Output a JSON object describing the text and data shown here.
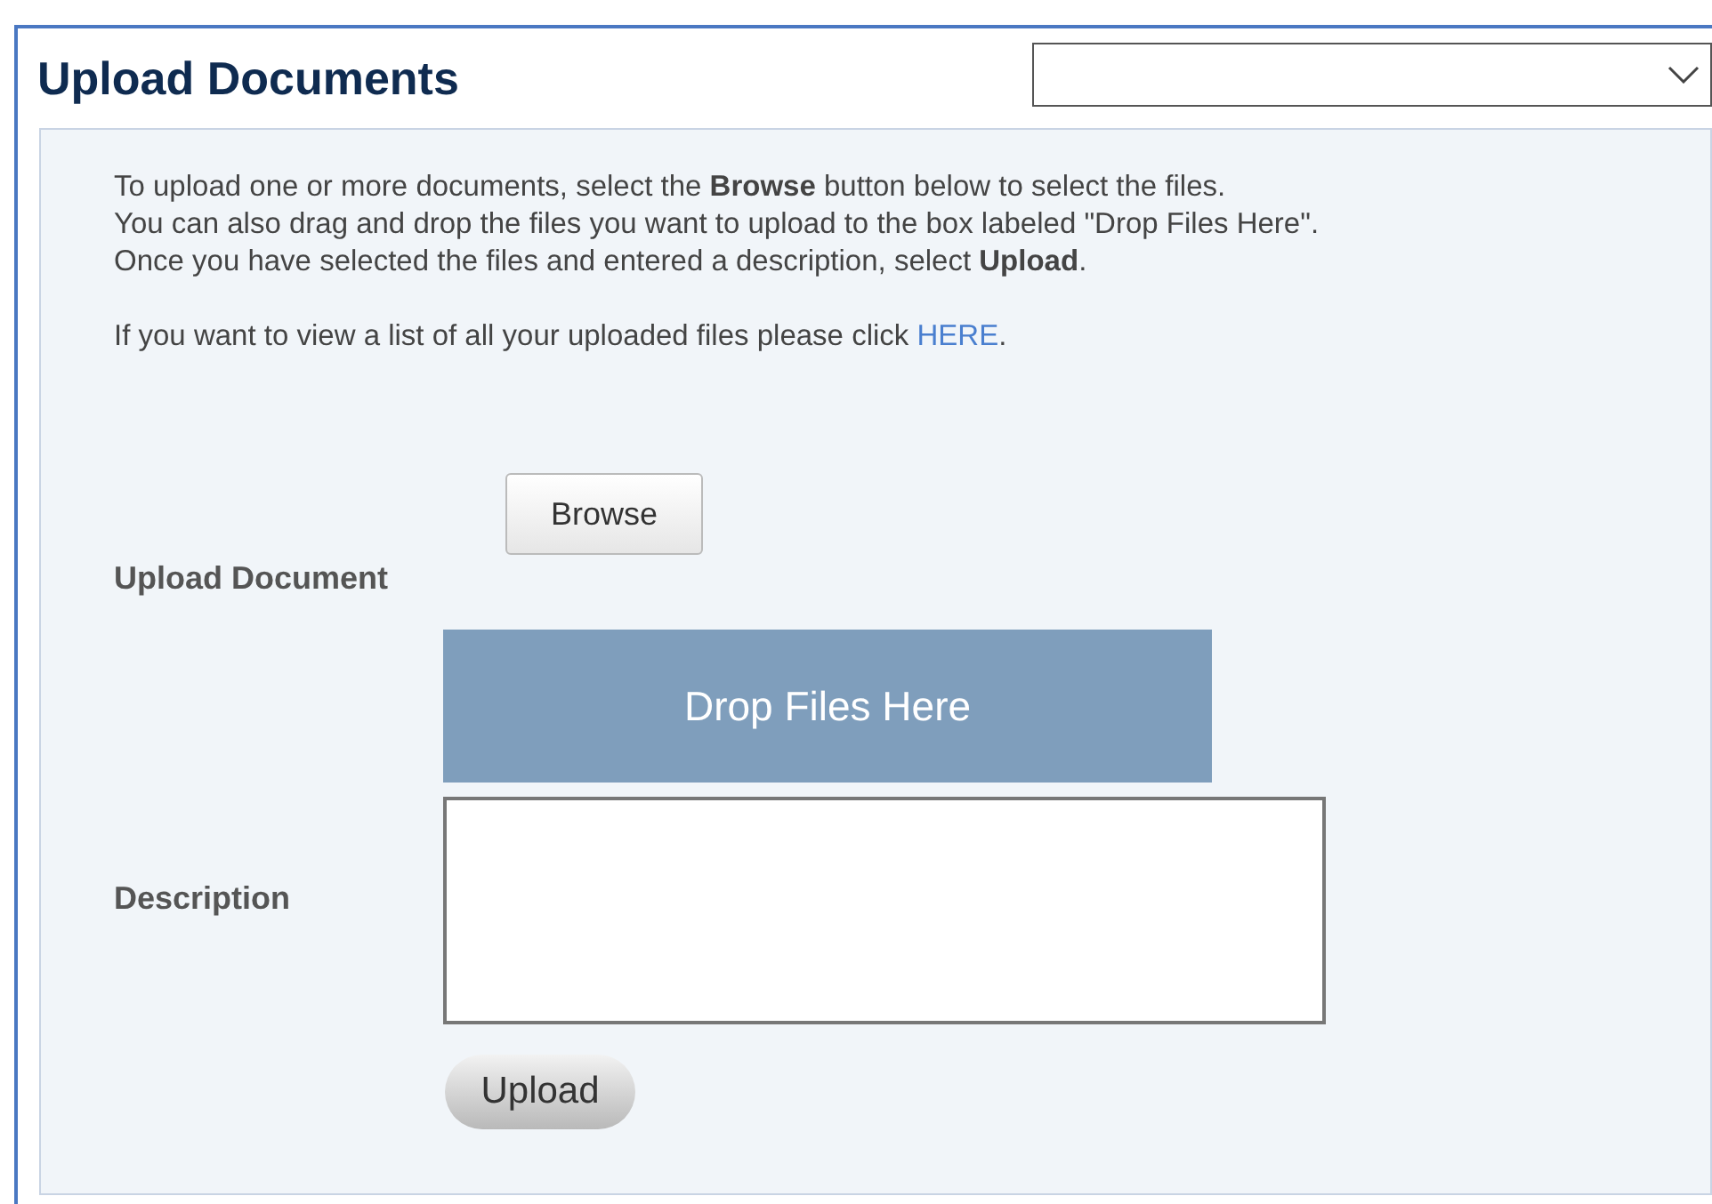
{
  "header": {
    "title": "Upload Documents"
  },
  "intro_lines": [
    "To upload one or more documents, select the **Browse** button below to select the files.",
    "You can also drag and drop the files you want to upload to the box labeled \"Drop Files Here\".",
    "Once you have selected the files and entered a description, select **Upload**."
  ],
  "list_link": {
    "text": "If you want to view a list of all your uploaded files please click",
    "link": "HERE",
    "after": "."
  },
  "form": {
    "browse_button": "Browse",
    "upload_label": "Upload Document",
    "drop_zone": "Drop Files Here",
    "description_label": "Description",
    "upload_button": "Upload"
  }
}
